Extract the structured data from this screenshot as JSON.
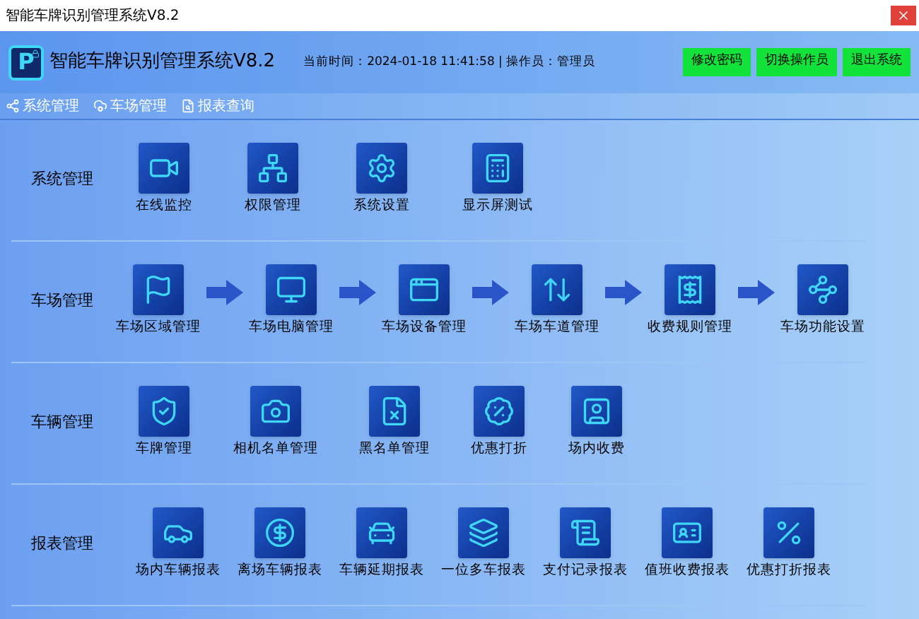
{
  "window": {
    "title": "智能车牌识别管理系统V8.2"
  },
  "header": {
    "logo_text": "P",
    "app_name": "智能车牌识别管理系统V8.2",
    "status": "当前时间：2024-01-18 11:41:58 | 操作员：管理员",
    "buttons": [
      "修改密码",
      "切换操作员",
      "退出系统"
    ]
  },
  "menu": [
    "系统管理",
    "车场管理",
    "报表查询"
  ],
  "sections": [
    {
      "title": "系统管理",
      "arrows": false,
      "items": [
        "在线监控",
        "权限管理",
        "系统设置",
        "显示屏测试"
      ]
    },
    {
      "title": "车场管理",
      "arrows": true,
      "items": [
        "车场区域管理",
        "车场电脑管理",
        "车场设备管理",
        "车场车道管理",
        "收费规则管理",
        "车场功能设置"
      ]
    },
    {
      "title": "车辆管理",
      "arrows": false,
      "items": [
        "车牌管理",
        "相机名单管理",
        "黑名单管理",
        "优惠打折",
        "场内收费"
      ]
    },
    {
      "title": "报表管理",
      "arrows": false,
      "items": [
        "场内车辆报表",
        "离场车辆报表",
        "车辆延期报表",
        "一位多车报表",
        "支付记录报表",
        "值班收费报表",
        "优惠打折报表"
      ]
    }
  ]
}
